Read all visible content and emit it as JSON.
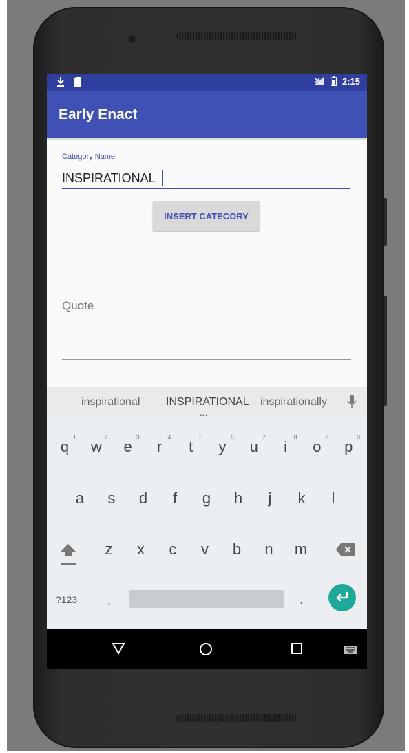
{
  "statusbar": {
    "left_icons": [
      "download-icon",
      "sd-card-icon"
    ],
    "time": "2:15",
    "right_icons": [
      "no-signal-icon",
      "battery-icon"
    ]
  },
  "appbar": {
    "title": "Early Enact",
    "color": "#3f51b5"
  },
  "form": {
    "category_label": "Category Name",
    "category_value": "INSPIRATIONAL",
    "insert_button_label": "INSERT CATECORY",
    "quote_placeholder": "Quote"
  },
  "keyboard": {
    "suggestions": [
      "inspirational",
      "INSPIRATIONAL",
      "inspirationally"
    ],
    "row1": [
      {
        "key": "q",
        "num": "1"
      },
      {
        "key": "w",
        "num": "2"
      },
      {
        "key": "e",
        "num": "3"
      },
      {
        "key": "r",
        "num": "4"
      },
      {
        "key": "t",
        "num": "5"
      },
      {
        "key": "y",
        "num": "6"
      },
      {
        "key": "u",
        "num": "7"
      },
      {
        "key": "i",
        "num": "8"
      },
      {
        "key": "o",
        "num": "9"
      },
      {
        "key": "p",
        "num": "0"
      }
    ],
    "row2": [
      "a",
      "s",
      "d",
      "f",
      "g",
      "h",
      "j",
      "k",
      "l"
    ],
    "row3": [
      "z",
      "x",
      "c",
      "v",
      "b",
      "n",
      "m"
    ],
    "symbols_key": "?123",
    "comma_key": ",",
    "period_key": ".",
    "enter_color": "#1da89a"
  },
  "navbar": {
    "icons": [
      "back-icon",
      "home-icon",
      "recents-icon",
      "keyboard-switch-icon"
    ]
  }
}
